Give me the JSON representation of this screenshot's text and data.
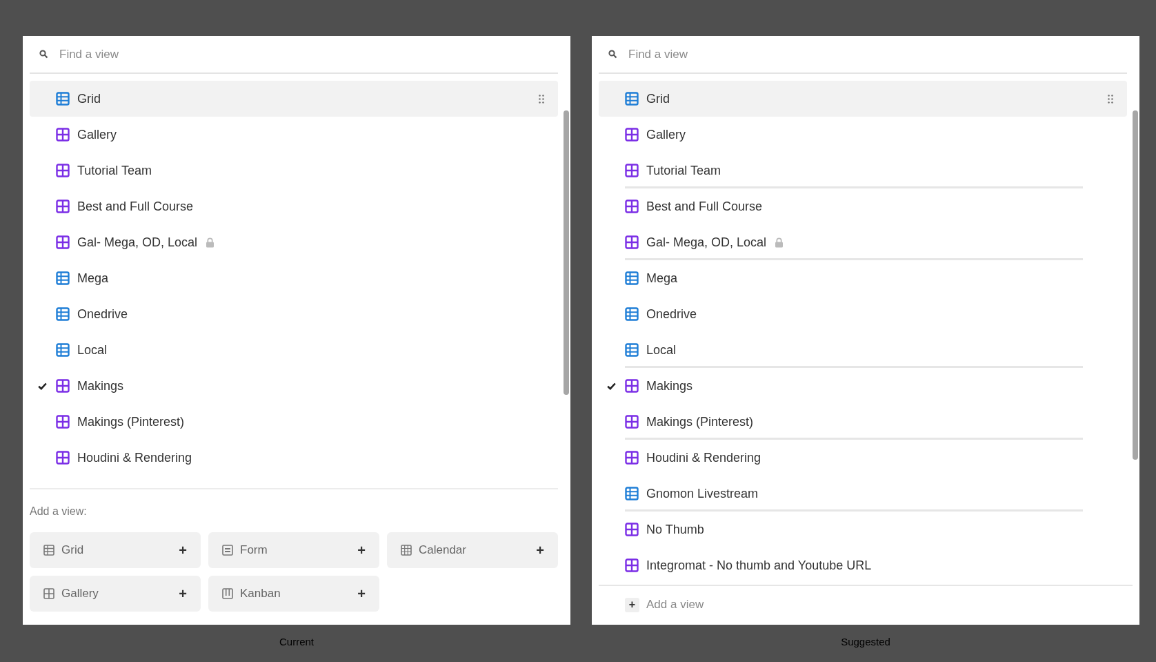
{
  "panels": [
    {
      "caption": "Current",
      "search": {
        "placeholder": "Find a view"
      },
      "views": [
        {
          "label": "Grid",
          "kind": "grid",
          "highlighted": true,
          "checked": false,
          "locked": false,
          "divider_below": false
        },
        {
          "label": "Gallery",
          "kind": "gallery",
          "highlighted": false,
          "checked": false,
          "locked": false,
          "divider_below": false
        },
        {
          "label": "Tutorial Team",
          "kind": "gallery",
          "highlighted": false,
          "checked": false,
          "locked": false,
          "divider_below": false
        },
        {
          "label": "Best and Full Course",
          "kind": "gallery",
          "highlighted": false,
          "checked": false,
          "locked": false,
          "divider_below": false
        },
        {
          "label": "Gal- Mega, OD, Local",
          "kind": "gallery",
          "highlighted": false,
          "checked": false,
          "locked": true,
          "divider_below": false
        },
        {
          "label": "Mega",
          "kind": "grid",
          "highlighted": false,
          "checked": false,
          "locked": false,
          "divider_below": false
        },
        {
          "label": "Onedrive",
          "kind": "grid",
          "highlighted": false,
          "checked": false,
          "locked": false,
          "divider_below": false
        },
        {
          "label": "Local",
          "kind": "grid",
          "highlighted": false,
          "checked": false,
          "locked": false,
          "divider_below": false
        },
        {
          "label": "Makings",
          "kind": "gallery",
          "highlighted": false,
          "checked": true,
          "locked": false,
          "divider_below": false
        },
        {
          "label": "Makings (Pinterest)",
          "kind": "gallery",
          "highlighted": false,
          "checked": false,
          "locked": false,
          "divider_below": false
        },
        {
          "label": "Houdini & Rendering",
          "kind": "gallery",
          "highlighted": false,
          "checked": false,
          "locked": false,
          "divider_below": false
        }
      ],
      "add_section": {
        "kind": "tiles",
        "heading": "Add a view:",
        "tiles": [
          {
            "label": "Grid",
            "kind": "grid",
            "action": "+"
          },
          {
            "label": "Form",
            "kind": "form",
            "action": "+"
          },
          {
            "label": "Calendar",
            "kind": "calendar",
            "action": "+"
          },
          {
            "label": "Gallery",
            "kind": "gallery",
            "action": "+"
          },
          {
            "label": "Kanban",
            "kind": "kanban",
            "action": "+"
          }
        ]
      }
    },
    {
      "caption": "Suggested",
      "search": {
        "placeholder": "Find a view"
      },
      "views": [
        {
          "label": "Grid",
          "kind": "grid",
          "highlighted": true,
          "checked": false,
          "locked": false,
          "divider_below": false
        },
        {
          "label": "Gallery",
          "kind": "gallery",
          "highlighted": false,
          "checked": false,
          "locked": false,
          "divider_below": false
        },
        {
          "label": "Tutorial Team",
          "kind": "gallery",
          "highlighted": false,
          "checked": false,
          "locked": false,
          "divider_below": true
        },
        {
          "label": "Best and Full Course",
          "kind": "gallery",
          "highlighted": false,
          "checked": false,
          "locked": false,
          "divider_below": false
        },
        {
          "label": "Gal- Mega, OD, Local",
          "kind": "gallery",
          "highlighted": false,
          "checked": false,
          "locked": true,
          "divider_below": true
        },
        {
          "label": "Mega",
          "kind": "grid",
          "highlighted": false,
          "checked": false,
          "locked": false,
          "divider_below": false
        },
        {
          "label": "Onedrive",
          "kind": "grid",
          "highlighted": false,
          "checked": false,
          "locked": false,
          "divider_below": false
        },
        {
          "label": "Local",
          "kind": "grid",
          "highlighted": false,
          "checked": false,
          "locked": false,
          "divider_below": true
        },
        {
          "label": "Makings",
          "kind": "gallery",
          "highlighted": false,
          "checked": true,
          "locked": false,
          "divider_below": false
        },
        {
          "label": "Makings (Pinterest)",
          "kind": "gallery",
          "highlighted": false,
          "checked": false,
          "locked": false,
          "divider_below": true
        },
        {
          "label": "Houdini & Rendering",
          "kind": "gallery",
          "highlighted": false,
          "checked": false,
          "locked": false,
          "divider_below": false
        },
        {
          "label": "Gnomon Livestream",
          "kind": "grid",
          "highlighted": false,
          "checked": false,
          "locked": false,
          "divider_below": true
        },
        {
          "label": "No Thumb",
          "kind": "gallery",
          "highlighted": false,
          "checked": false,
          "locked": false,
          "divider_below": false
        },
        {
          "label": "Integromat - No thumb and Youtube URL",
          "kind": "gallery",
          "highlighted": false,
          "checked": false,
          "locked": false,
          "divider_below": false
        }
      ],
      "add_section": {
        "kind": "link",
        "label": "Add a view",
        "action": "+"
      }
    }
  ]
}
